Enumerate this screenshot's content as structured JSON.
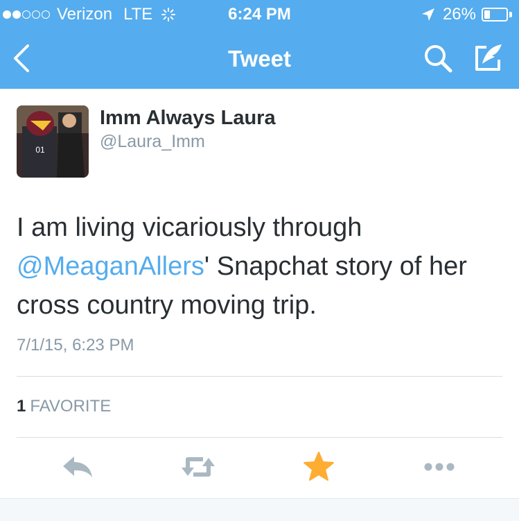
{
  "status_bar": {
    "signal_strength": "2 of 5",
    "carrier": "Verizon",
    "network": "LTE",
    "time": "6:24 PM",
    "battery_percent": "26%",
    "battery_level": 0.26
  },
  "nav": {
    "title": "Tweet",
    "icons": [
      "back-icon",
      "search-icon",
      "compose-icon"
    ]
  },
  "tweet": {
    "author_name": "Imm Always Laura",
    "author_handle": "@Laura_Imm",
    "text_before": "I am living vicariously through ",
    "mention": "@MeaganAllers",
    "text_after": "' Snapchat story of her cross country moving trip.",
    "timestamp": "7/1/15, 6:23 PM",
    "favorite_count": "1",
    "favorite_label": "FAVORITE"
  },
  "actions": [
    "reply-icon",
    "retweet-icon",
    "favorite-star-icon",
    "more-icon"
  ],
  "colors": {
    "brand_blue": "#55acee",
    "text": "#292f33",
    "muted": "#8899a6",
    "favorite": "#ffac33",
    "action_gray": "#aab8c2"
  }
}
